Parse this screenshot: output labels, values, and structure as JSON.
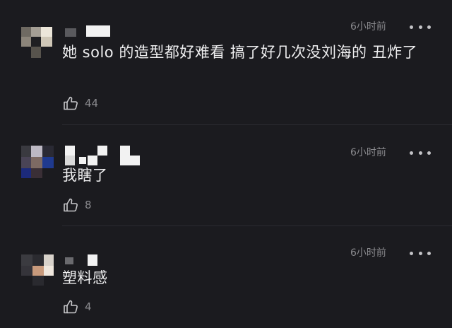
{
  "comments": [
    {
      "time": "6小时前",
      "text": "她 solo 的造型都好难看  搞了好几次没刘海的  丑炸了",
      "likes": "44"
    },
    {
      "time": "6小时前",
      "text": "我瞎了",
      "likes": "8"
    },
    {
      "time": "6小时前",
      "text": "塑料感",
      "likes": "4"
    }
  ]
}
